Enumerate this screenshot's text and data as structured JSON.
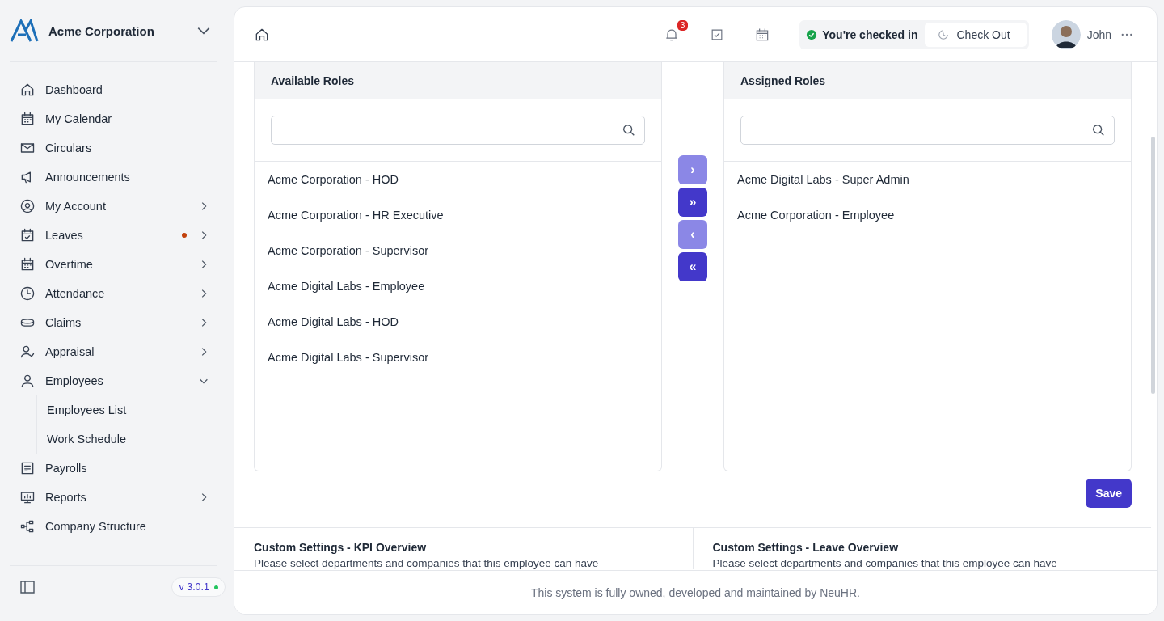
{
  "sidebar": {
    "company": "Acme Corporation",
    "items": [
      {
        "label": "Dashboard"
      },
      {
        "label": "My Calendar"
      },
      {
        "label": "Circulars"
      },
      {
        "label": "Announcements"
      },
      {
        "label": "My Account",
        "expanded": false
      },
      {
        "label": "Leaves",
        "expanded": false,
        "dot": true
      },
      {
        "label": "Overtime",
        "expanded": false
      },
      {
        "label": "Attendance",
        "expanded": false
      },
      {
        "label": "Claims",
        "expanded": false
      },
      {
        "label": "Appraisal",
        "expanded": false
      },
      {
        "label": "Employees",
        "expanded": true,
        "children": [
          {
            "label": "Employees List"
          },
          {
            "label": "Work Schedule"
          }
        ]
      },
      {
        "label": "Payrolls"
      },
      {
        "label": "Reports",
        "expanded": false
      },
      {
        "label": "Company Structure"
      }
    ],
    "version": "v 3.0.1"
  },
  "header": {
    "notifications": "3",
    "status": "You're checked in",
    "check_out": "Check Out",
    "user": "John"
  },
  "available": {
    "title": "Available Roles",
    "items": [
      "Acme Corporation - HOD",
      "Acme Corporation - HR Executive",
      "Acme Corporation - Supervisor",
      "Acme Digital Labs - Employee",
      "Acme Digital Labs - HOD",
      "Acme Digital Labs - Supervisor"
    ]
  },
  "transfer_buttons": [
    {
      "label": "›",
      "disabled": true
    },
    {
      "label": "»",
      "disabled": false
    },
    {
      "label": "‹",
      "disabled": true
    },
    {
      "label": "«",
      "disabled": false
    }
  ],
  "assigned": {
    "title": "Assigned Roles",
    "items": [
      "Acme Digital Labs - Super Admin",
      "Acme Corporation - Employee"
    ]
  },
  "save": "Save",
  "settings": [
    {
      "title": "Custom Settings - KPI Overview",
      "text": "Please select departments and companies that this employee can have"
    },
    {
      "title": "Custom Settings - Leave Overview",
      "text": "Please select departments and companies that this employee can have"
    }
  ],
  "footer": "This system is fully owned, developed and maintained by NeuHR."
}
